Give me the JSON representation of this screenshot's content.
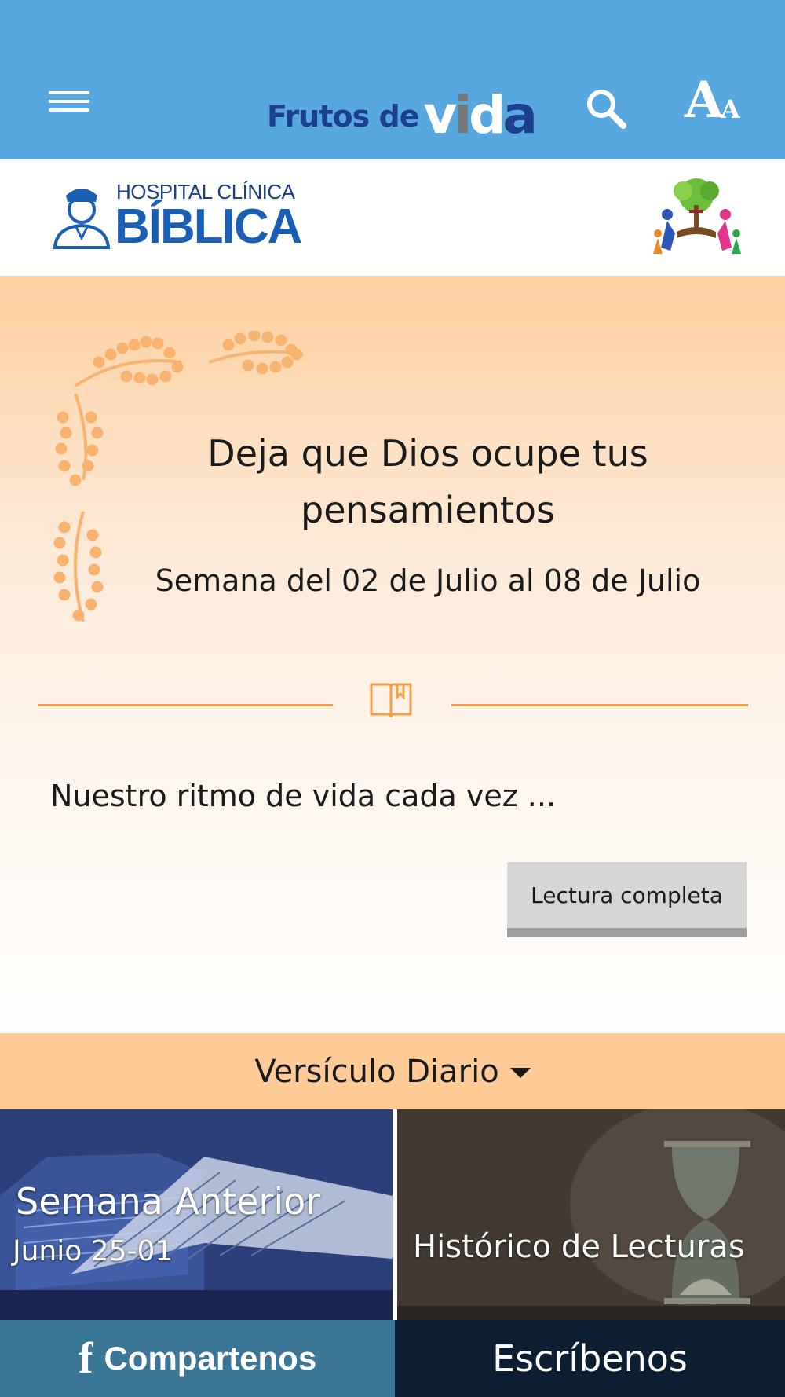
{
  "header": {
    "logo_part1": "Frutos de",
    "logo_v": "v",
    "logo_i": "i",
    "logo_d": "d",
    "logo_a": "a",
    "font_big": "A",
    "font_small": "A",
    "background_color": "#58a8df"
  },
  "sponsor": {
    "hospital_line1": "HOSPITAL CLÍNICA",
    "hospital_line2": "BÍBLICA"
  },
  "reading": {
    "title_line1": "Deja que Dios ocupe tus",
    "title_line2": "pensamientos",
    "week": "Semana del 02 de Julio al 08 de Julio",
    "excerpt": "Nuestro ritmo de vida cada vez ...",
    "button_label": "Lectura completa",
    "accent_color": "#f0a048"
  },
  "verse_bar": {
    "label": "Versículo Diario"
  },
  "tiles": {
    "previous_title": "Semana Anterior",
    "previous_range": "Junio 25-01",
    "history_title": "Histórico de Lecturas"
  },
  "bottom_nav": {
    "share_label": "Compartenos",
    "share_icon": "f",
    "write_label": "Escríbenos"
  }
}
